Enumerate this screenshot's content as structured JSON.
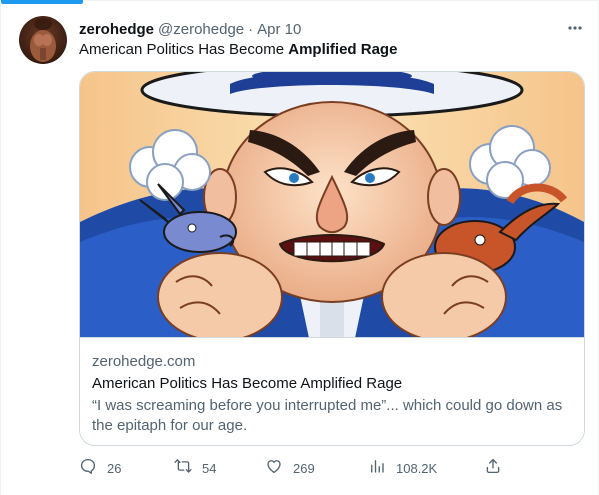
{
  "tweet": {
    "author_name": "zerohedge",
    "handle": "@zerohedge",
    "separator": "·",
    "date": "Apr 10",
    "text_prefix": "American Politics Has Become ",
    "text_bold": "Amplified Rage"
  },
  "card": {
    "domain": "zerohedge.com",
    "title": "American Politics Has Become Amplified Rage",
    "description": "“I was screaming before you interrupted me”... which could go down as the epitaph for our age."
  },
  "actions": {
    "replies": "26",
    "retweets": "54",
    "likes": "269",
    "views": "108.2K"
  },
  "icons": {
    "more": "more-horizontal-icon",
    "reply": "reply-icon",
    "retweet": "retweet-icon",
    "like": "heart-icon",
    "views": "views-chart-icon",
    "share": "share-icon"
  },
  "colors": {
    "accent": "#1d9bf0",
    "text_primary": "#0f1419",
    "text_secondary": "#536471",
    "border": "#cfd9de"
  }
}
